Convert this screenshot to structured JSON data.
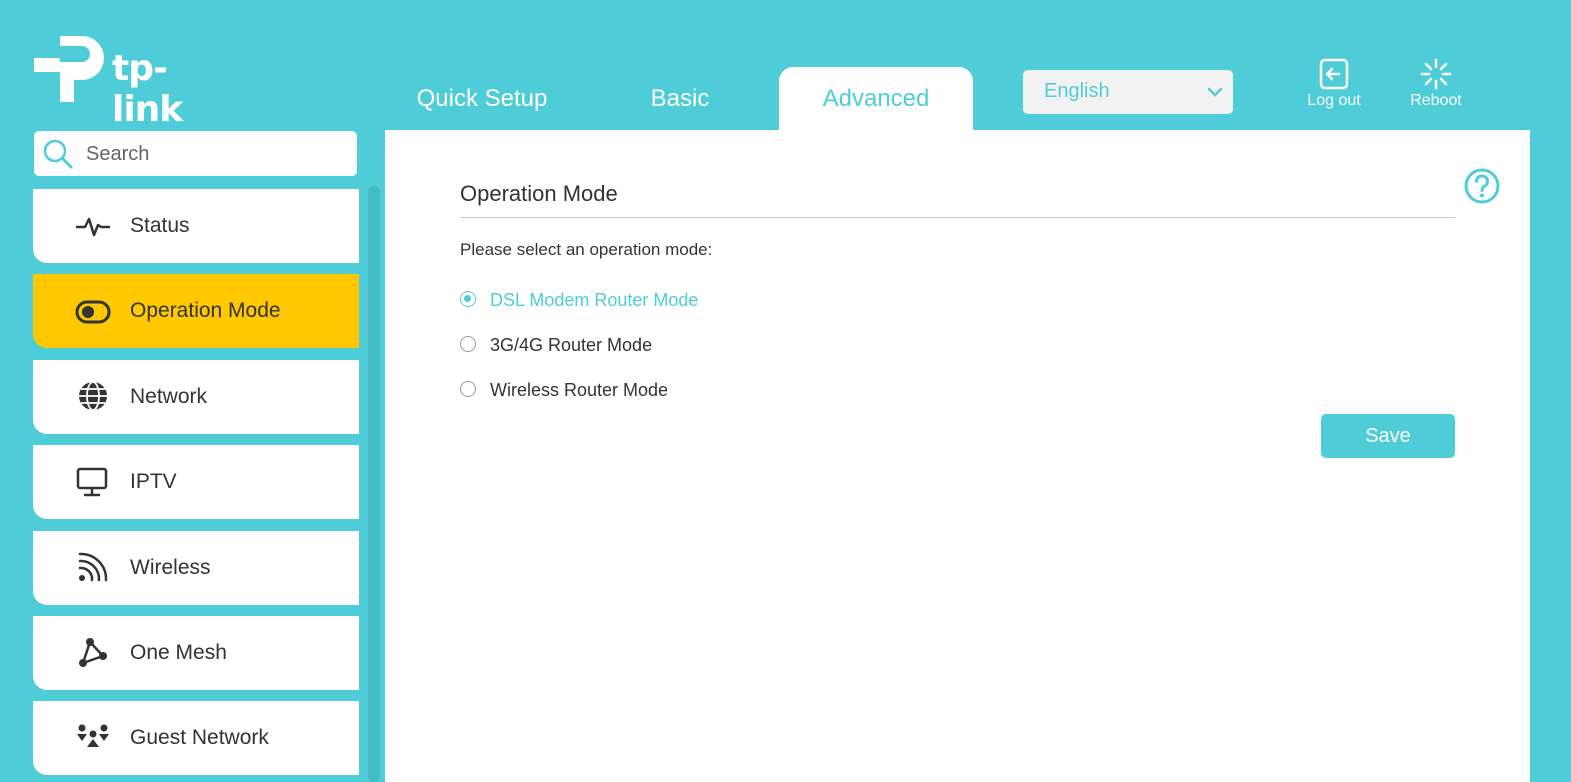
{
  "brand": {
    "logo_text": "tp-link"
  },
  "tabs": [
    {
      "label": "Quick Setup"
    },
    {
      "label": "Basic"
    },
    {
      "label": "Advanced",
      "active": true
    }
  ],
  "language": {
    "selected": "English"
  },
  "actions": {
    "logout": "Log out",
    "reboot": "Reboot"
  },
  "search": {
    "placeholder": "Search"
  },
  "sidebar": {
    "items": [
      {
        "label": "Status",
        "icon": "pulse-icon"
      },
      {
        "label": "Operation Mode",
        "icon": "toggle-icon",
        "active": true
      },
      {
        "label": "Network",
        "icon": "globe-icon"
      },
      {
        "label": "IPTV",
        "icon": "monitor-icon"
      },
      {
        "label": "Wireless",
        "icon": "wifi-icon"
      },
      {
        "label": "One Mesh",
        "icon": "mesh-icon"
      },
      {
        "label": "Guest Network",
        "icon": "guests-icon"
      }
    ]
  },
  "main": {
    "title": "Operation Mode",
    "prompt": "Please select an operation mode:",
    "options": [
      {
        "label": "DSL Modem Router Mode",
        "selected": true
      },
      {
        "label": "3G/4G Router Mode",
        "selected": false
      },
      {
        "label": "Wireless Router Mode",
        "selected": false
      }
    ],
    "save_label": "Save"
  },
  "colors": {
    "accent": "#4ecdd8",
    "active_nav": "#ffc800",
    "panel": "#ffffff"
  }
}
